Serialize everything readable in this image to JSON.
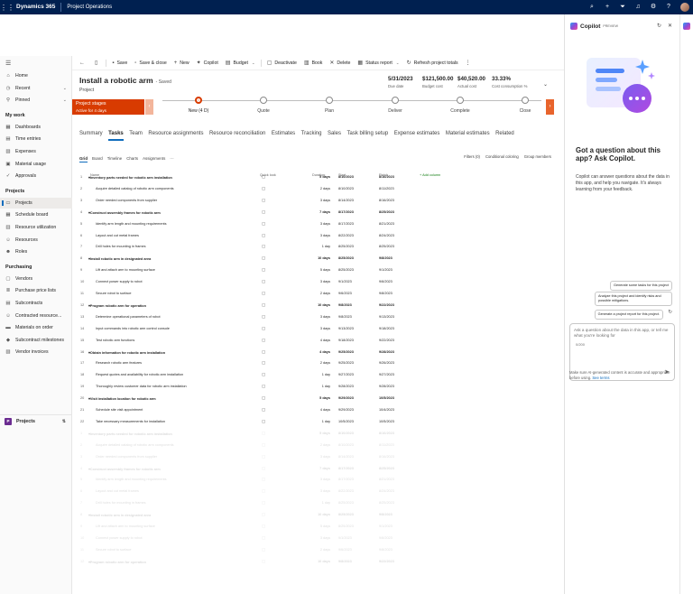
{
  "topbar": {
    "brand": "Dynamics 365",
    "module": "Project Operations",
    "icons": [
      "search-icon",
      "add-icon",
      "filter-icon",
      "bell-icon",
      "settings-icon",
      "help-icon",
      "avatar"
    ]
  },
  "nav": {
    "items_top": [
      {
        "label": "Home",
        "icon": "home-icon"
      },
      {
        "label": "Recent",
        "icon": "clock-icon",
        "chev": true
      },
      {
        "label": "Pinned",
        "icon": "pin-icon",
        "chev": true
      }
    ],
    "my_work_label": "My work",
    "my_work": [
      {
        "label": "Dashboards",
        "icon": "dashboard-icon"
      },
      {
        "label": "Time entries",
        "icon": "calendar-icon"
      },
      {
        "label": "Expenses",
        "icon": "receipt-icon"
      },
      {
        "label": "Material usage",
        "icon": "box-icon"
      },
      {
        "label": "Approvals",
        "icon": "check-icon"
      }
    ],
    "projects_label": "Projects",
    "projects": [
      {
        "label": "Projects",
        "icon": "folder-icon",
        "active": true
      },
      {
        "label": "Schedule board",
        "icon": "board-icon"
      },
      {
        "label": "Resource utilization",
        "icon": "chart-icon"
      },
      {
        "label": "Resources",
        "icon": "people-icon"
      },
      {
        "label": "Roles",
        "icon": "person-icon"
      }
    ],
    "purchasing_label": "Purchasing",
    "purchasing": [
      {
        "label": "Vendors",
        "icon": "vendor-icon"
      },
      {
        "label": "Purchase price lists",
        "icon": "list-icon"
      },
      {
        "label": "Subcontracts",
        "icon": "contract-icon"
      },
      {
        "label": "Contracted resource...",
        "icon": "people-icon"
      },
      {
        "label": "Materials on order",
        "icon": "cart-icon"
      },
      {
        "label": "Subcontract milestones",
        "icon": "milestone-icon"
      },
      {
        "label": "Vendor invoices",
        "icon": "invoice-icon"
      }
    ],
    "area": {
      "badge": "P",
      "label": "Projects"
    }
  },
  "commands": [
    {
      "label": "",
      "icon": "back-icon"
    },
    {
      "label": "",
      "icon": "form-icon"
    },
    {
      "label": "Save",
      "icon": "save-icon"
    },
    {
      "label": "Save & close",
      "icon": "save-close-icon"
    },
    {
      "label": "New",
      "icon": "plus-icon"
    },
    {
      "label": "Copilot",
      "icon": "copilot-icon"
    },
    {
      "label": "Budget",
      "icon": "budget-icon",
      "caret": true
    },
    {
      "label": "Deactivate",
      "icon": "deactivate-icon"
    },
    {
      "label": "Book",
      "icon": "book-icon"
    },
    {
      "label": "Delete",
      "icon": "delete-icon"
    },
    {
      "label": "Status report",
      "icon": "report-icon",
      "caret": true
    },
    {
      "label": "Refresh project totals",
      "icon": "refresh-icon"
    },
    {
      "label": "",
      "icon": "more-icon"
    }
  ],
  "header": {
    "title": "Install a robotic arm",
    "saved": "- Saved",
    "entity": "Project",
    "fields": [
      {
        "value": "5/31/2023",
        "label": "Due date"
      },
      {
        "value": "$121,500.00",
        "label": "Budget cost"
      },
      {
        "value": "$40,520.00",
        "label": "Actual cost"
      },
      {
        "value": "33.33%",
        "label": "Cost consumption %"
      }
    ]
  },
  "bpf": {
    "box_title": "Project stages",
    "box_sub": "Active for 4 days",
    "stages": [
      "New (4 D)",
      "Quote",
      "Plan",
      "Deliver",
      "Complete",
      "Close"
    ],
    "active_stage": 0
  },
  "tabs": [
    "Summary",
    "Tasks",
    "Team",
    "Resource assignments",
    "Resource reconciliation",
    "Estimates",
    "Tracking",
    "Sales",
    "Task billing setup",
    "Expense estimates",
    "Material estimates",
    "Related"
  ],
  "active_tab": 1,
  "subtabs": [
    "Grid",
    "Board",
    "Timeline",
    "Charts",
    "Assignments",
    "···"
  ],
  "gridtools": [
    "Filters (0)",
    "Conditional coloring",
    "Group members"
  ],
  "grid": {
    "headers": {
      "name": "Name",
      "quick_look": "Quick look",
      "duration": "Duration",
      "start": "Start",
      "finish": "Finish",
      "add": "+ Add column"
    },
    "rows": [
      {
        "n": "1",
        "name": "Inventory parts needed for robotic arm installation",
        "dur": "5 days",
        "start": "8/10/2023",
        "end": "8/16/2023",
        "summary": true
      },
      {
        "n": "2",
        "name": "Acquire detailed catalog of robotic arm components",
        "dur": "2 days",
        "start": "8/10/2023",
        "end": "8/11/2023"
      },
      {
        "n": "3",
        "name": "Order needed components from supplier",
        "dur": "3 days",
        "start": "8/14/2023",
        "end": "8/16/2023"
      },
      {
        "n": "4",
        "name": "Construct assembly frames for robotic arm",
        "dur": "7 days",
        "start": "8/17/2023",
        "end": "8/25/2023",
        "summary": true
      },
      {
        "n": "5",
        "name": "Identify arm length and mounting requirements",
        "dur": "3 days",
        "start": "8/17/2023",
        "end": "8/21/2023"
      },
      {
        "n": "6",
        "name": "Layout and cut metal frames",
        "dur": "3 days",
        "start": "8/22/2023",
        "end": "8/24/2023"
      },
      {
        "n": "7",
        "name": "Drill holes for mounting in frames",
        "dur": "1 day",
        "start": "8/25/2023",
        "end": "8/25/2023"
      },
      {
        "n": "8",
        "name": "Install robotic arm in designated area",
        "dur": "10 days",
        "start": "8/25/2023",
        "end": "9/8/2023",
        "summary": true
      },
      {
        "n": "9",
        "name": "Lift and attach arm to mounting surface",
        "dur": "5 days",
        "start": "8/25/2023",
        "end": "9/1/2023"
      },
      {
        "n": "10",
        "name": "Connect power supply to robot",
        "dur": "3 days",
        "start": "9/1/2023",
        "end": "9/6/2023"
      },
      {
        "n": "11",
        "name": "Secure robot to surface",
        "dur": "2 days",
        "start": "9/6/2023",
        "end": "9/8/2023"
      },
      {
        "n": "12",
        "name": "Program robotic arm for operation",
        "dur": "10 days",
        "start": "9/8/2023",
        "end": "9/22/2023",
        "summary": true
      },
      {
        "n": "13",
        "name": "Determine operational parameters of robot",
        "dur": "3 days",
        "start": "9/8/2023",
        "end": "9/13/2023"
      },
      {
        "n": "14",
        "name": "Input commands into robotic arm control console",
        "dur": "3 days",
        "start": "9/13/2023",
        "end": "9/18/2023"
      },
      {
        "n": "15",
        "name": "Test robotic arm functions",
        "dur": "4 days",
        "start": "9/18/2023",
        "end": "9/22/2023"
      },
      {
        "n": "16",
        "name": "Obtain information for robotic arm installation",
        "dur": "4 days",
        "start": "9/25/2023",
        "end": "9/28/2023",
        "summary": true
      },
      {
        "n": "17",
        "name": "Research robotic arm features",
        "dur": "2 days",
        "start": "9/25/2023",
        "end": "9/26/2023"
      },
      {
        "n": "18",
        "name": "Request quotes and availability for robotic arm installation",
        "dur": "1 day",
        "start": "9/27/2023",
        "end": "9/27/2023"
      },
      {
        "n": "19",
        "name": "Thoroughly review customer data for robotic arm installation",
        "dur": "1 day",
        "start": "9/28/2023",
        "end": "9/28/2023"
      },
      {
        "n": "20",
        "name": "Visit installation location for robotic arm",
        "dur": "5 days",
        "start": "9/29/2023",
        "end": "10/5/2023",
        "summary": true
      },
      {
        "n": "21",
        "name": "Schedule site visit appointment",
        "dur": "4 days",
        "start": "9/29/2023",
        "end": "10/4/2023"
      },
      {
        "n": "22",
        "name": "Take necessary measurements for installation",
        "dur": "1 day",
        "start": "10/5/2023",
        "end": "10/5/2023"
      }
    ],
    "faded_rows": [
      {
        "n": "1",
        "name": "Inventory parts needed for robotic arm installation",
        "dur": "5 days",
        "start": "8/10/2023",
        "end": "8/16/2023",
        "summary": true
      },
      {
        "n": "2",
        "name": "Acquire detailed catalog of robotic arm components",
        "dur": "2 days",
        "start": "8/10/2023",
        "end": "8/11/2023"
      },
      {
        "n": "3",
        "name": "Order needed components from supplier",
        "dur": "3 days",
        "start": "8/14/2023",
        "end": "8/16/2023"
      },
      {
        "n": "4",
        "name": "Construct assembly frames for robotic arm",
        "dur": "7 days",
        "start": "8/17/2023",
        "end": "8/25/2023",
        "summary": true
      },
      {
        "n": "5",
        "name": "Identify arm length and mounting requirements",
        "dur": "3 days",
        "start": "8/17/2023",
        "end": "8/21/2023"
      },
      {
        "n": "6",
        "name": "Layout and cut metal frames",
        "dur": "3 days",
        "start": "8/22/2023",
        "end": "8/24/2023"
      },
      {
        "n": "7",
        "name": "Drill holes for mounting in frames",
        "dur": "1 day",
        "start": "8/25/2023",
        "end": "8/25/2023"
      },
      {
        "n": "8",
        "name": "Install robotic arm in designated area",
        "dur": "10 days",
        "start": "8/25/2023",
        "end": "9/8/2023",
        "summary": true
      },
      {
        "n": "9",
        "name": "Lift and attach arm to mounting surface",
        "dur": "5 days",
        "start": "8/25/2023",
        "end": "9/1/2023"
      },
      {
        "n": "10",
        "name": "Connect power supply to robot",
        "dur": "3 days",
        "start": "9/1/2023",
        "end": "9/6/2023"
      },
      {
        "n": "11",
        "name": "Secure robot to surface",
        "dur": "2 days",
        "start": "9/6/2023",
        "end": "9/8/2023"
      },
      {
        "n": "12",
        "name": "Program robotic arm for operation",
        "dur": "10 days",
        "start": "9/8/2023",
        "end": "9/22/2023",
        "summary": true
      }
    ]
  },
  "copilot": {
    "title": "Copilot",
    "preview": "PREVIEW",
    "question": "Got a question about this app? Ask Copilot.",
    "body": "Copilot can answer questions about the data in this app, and help you navigate. It's always learning from your feedback.",
    "suggestions": [
      "Generate some tasks for this project",
      "Analyze this project and identify risks and possible mitigations.",
      "Generate a project report for this project."
    ],
    "input_placeholder": "Ask a question about the data in this app, or tell me what you're looking for",
    "counter": "0/200",
    "disclaimer": "Make sure AI-generated content is accurate and appropriate before using.",
    "terms_link": "See terms",
    "colors": {
      "accent": "#8e4ad9",
      "stage": "#d83b01",
      "nav_bar": "#002050"
    }
  }
}
